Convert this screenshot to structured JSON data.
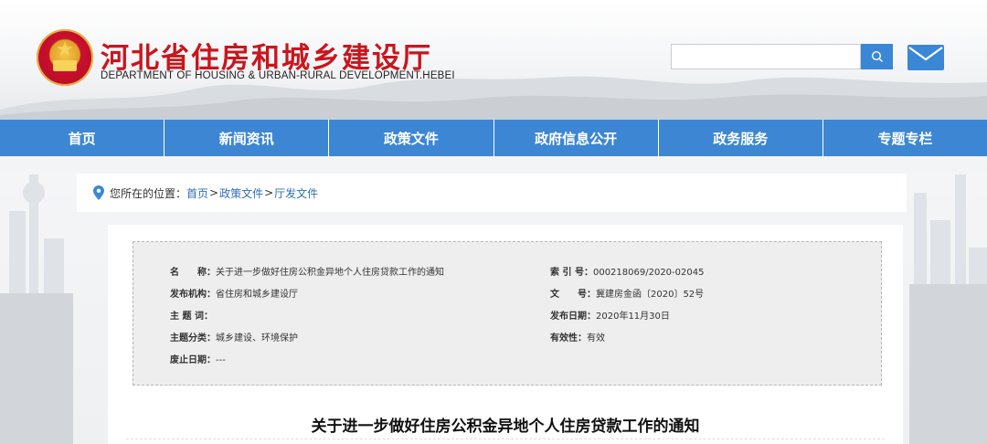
{
  "header": {
    "title": "河北省住房和城乡建设厅",
    "subtitle": "DEPARTMENT OF HOUSING & URBAN-RURAL DEVELOPMENT.HEBEI",
    "search": {
      "value": "",
      "placeholder": ""
    },
    "icons": {
      "search": "search-icon",
      "mail": "mail-icon",
      "emblem": "national-emblem"
    }
  },
  "nav": {
    "items": [
      {
        "label": "首页"
      },
      {
        "label": "新闻资讯"
      },
      {
        "label": "政策文件"
      },
      {
        "label": "政府信息公开"
      },
      {
        "label": "政务服务"
      },
      {
        "label": "专题专栏"
      }
    ]
  },
  "breadcrumb": {
    "label": "您所在的位置：",
    "items": [
      "首页",
      "政策文件",
      "厅发文件"
    ],
    "separator": ">"
  },
  "meta": {
    "name_key": "名　　称：",
    "name_value": "关于进一步做好住房公积金异地个人住房贷款工作的通知",
    "index_key": "索 引 号：",
    "index_value": "000218069/2020-02045",
    "org_key": "发布机构：",
    "org_value": "省住房和城乡建设厅",
    "docno_key": "文　　号：",
    "docno_value": "冀建房金函〔2020〕52号",
    "subject_key": "主 题 词：",
    "subject_value": "",
    "date_key": "发布日期：",
    "date_value": "2020年11月30日",
    "category_key": "主题分类：",
    "category_value": "城乡建设、环境保护",
    "validity_key": "有效性：",
    "validity_value": "有效",
    "expiry_key": "废止日期：",
    "expiry_value": "---"
  },
  "article": {
    "title": "关于进一步做好住房公积金异地个人住房贷款工作的通知"
  },
  "colors": {
    "brand_red": "#c9161d",
    "nav_blue": "#3d86d3",
    "link_blue": "#2d6fb8",
    "search_blue": "#3a87d6"
  }
}
